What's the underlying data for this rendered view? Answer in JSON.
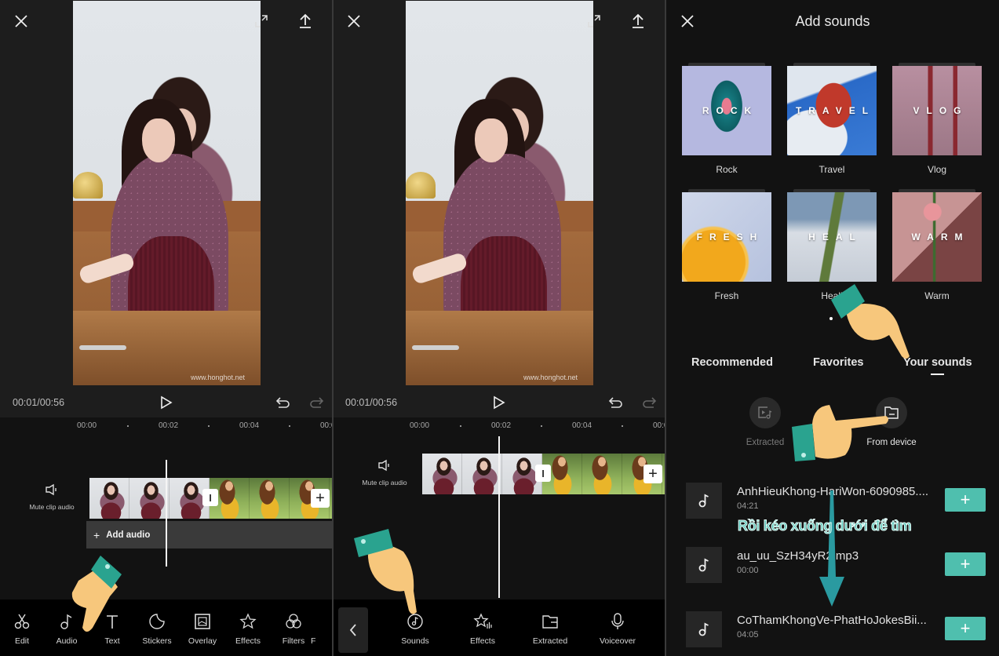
{
  "panel1": {
    "top_icons": [
      "close-icon",
      "fullscreen-icon",
      "export-icon"
    ],
    "timecode": "00:01/00:56",
    "watermark": "www.honghot.net",
    "ruler": [
      "00:00",
      "00:02",
      "00:04",
      "00:0"
    ],
    "mute_label": "Mute clip audio",
    "add_audio_label": "Add audio",
    "toolbar": [
      {
        "label": "Edit",
        "icon": "scissors-icon"
      },
      {
        "label": "Audio",
        "icon": "music-note-icon"
      },
      {
        "label": "Text",
        "icon": "text-icon"
      },
      {
        "label": "Stickers",
        "icon": "sticker-icon"
      },
      {
        "label": "Overlay",
        "icon": "overlay-icon"
      },
      {
        "label": "Effects",
        "icon": "effects-star-icon"
      },
      {
        "label": "Filters",
        "icon": "filters-icon"
      },
      {
        "label": "F",
        "icon": ""
      }
    ]
  },
  "panel2": {
    "timecode": "00:01/00:56",
    "watermark": "www.honghot.net",
    "ruler": [
      "00:00",
      "00:02",
      "00:04",
      "00:0"
    ],
    "mute_label": "Mute clip audio",
    "toolbar": [
      {
        "label": "Sounds",
        "icon": "music-disc-icon"
      },
      {
        "label": "Effects",
        "icon": "sound-effects-icon"
      },
      {
        "label": "Extracted",
        "icon": "folder-icon"
      },
      {
        "label": "Voiceover",
        "icon": "microphone-icon"
      }
    ]
  },
  "panel3": {
    "title": "Add sounds",
    "categories": [
      {
        "name": "Rock",
        "overlay": "ROCK"
      },
      {
        "name": "Travel",
        "overlay": "TRAVEL"
      },
      {
        "name": "Vlog",
        "overlay": "VLOG"
      },
      {
        "name": "Fresh",
        "overlay": "FRESH"
      },
      {
        "name": "Heali",
        "overlay": "HEAL"
      },
      {
        "name": "Warm",
        "overlay": "WARM"
      }
    ],
    "tabs": [
      "Recommended",
      "Favorites",
      "Your sounds"
    ],
    "active_tab": "Your sounds",
    "sources": [
      {
        "label": "Extracted",
        "icon": "extract-video-icon"
      },
      {
        "label": "From device",
        "icon": "device-folder-icon"
      }
    ],
    "songs": [
      {
        "name": "AnhHieuKhong-HariWon-6090985....",
        "duration": "04:21"
      },
      {
        "name": "au_uu_SzH34yR2.mp3",
        "duration": "00:00"
      },
      {
        "name": "CoThamKhongVe-PhatHoJokesBii...",
        "duration": "04:05"
      }
    ],
    "annotation": "Rồi kéo xuống dưới để tìm",
    "accent_color": "#4fbfae"
  }
}
